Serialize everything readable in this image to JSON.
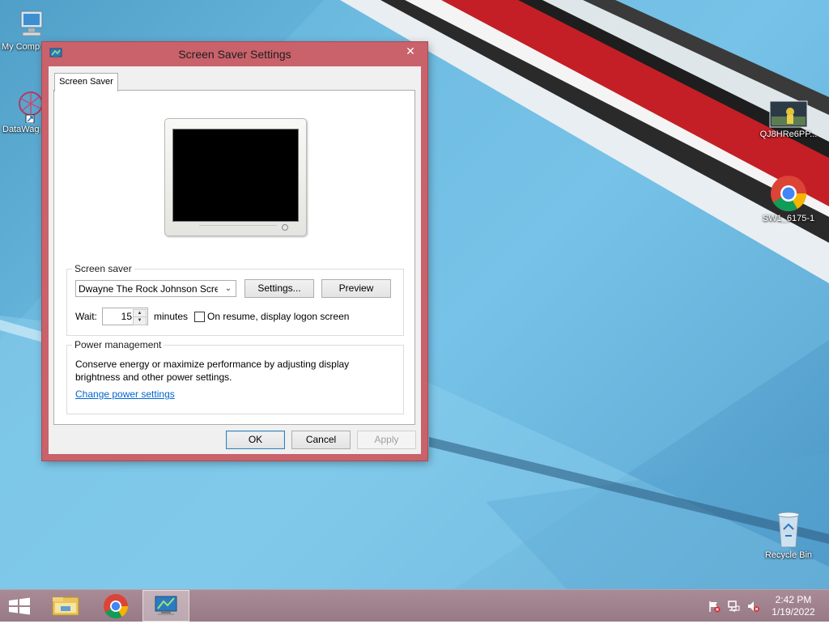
{
  "desktop": {
    "icons": [
      {
        "label": "My Comp",
        "icon": "my-computer-icon"
      },
      {
        "label": "DataWag",
        "icon": "datawag-shortcut-icon"
      },
      {
        "label": "QJ8HRe6PP...",
        "icon": "image-file-icon"
      },
      {
        "label": "SW1_6175-1",
        "icon": "chrome-icon"
      },
      {
        "label": "Recycle Bin",
        "icon": "recycle-bin-icon"
      }
    ]
  },
  "dialog": {
    "title": "Screen Saver Settings",
    "close_glyph": "✕",
    "tab_label": "Screen Saver",
    "screen_saver": {
      "group_label": "Screen saver",
      "selected": "Dwayne The Rock Johnson Screensaver",
      "settings_label": "Settings...",
      "preview_label": "Preview",
      "wait_label": "Wait:",
      "wait_value": "15",
      "minutes_label": "minutes",
      "resume_checkbox_label": "On resume, display logon screen",
      "resume_checked": false
    },
    "power": {
      "group_label": "Power management",
      "description": "Conserve energy or maximize performance by adjusting display brightness and other power settings.",
      "link_label": "Change power settings"
    },
    "buttons": {
      "ok": "OK",
      "cancel": "Cancel",
      "apply": "Apply"
    }
  },
  "taskbar": {
    "items": [
      "start-button",
      "file-explorer",
      "chrome",
      "screen-saver-settings"
    ],
    "clock": {
      "time": "2:42 PM",
      "date": "1/19/2022"
    }
  },
  "colors": {
    "window_frame": "#c9626a",
    "taskbar": "#a0838e",
    "link": "#0066cc"
  }
}
